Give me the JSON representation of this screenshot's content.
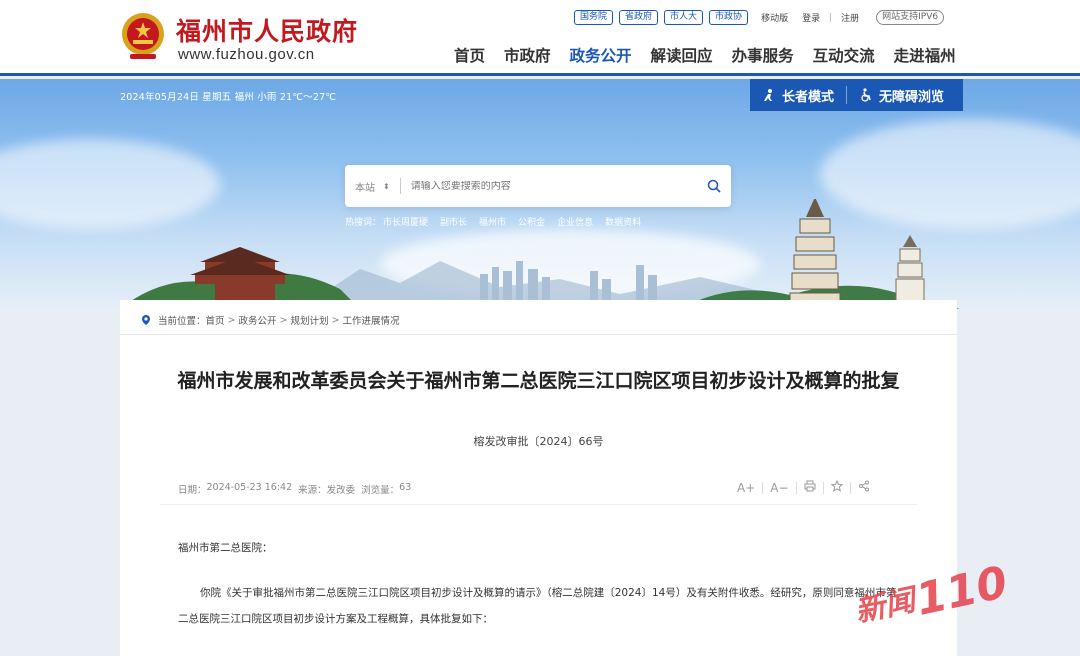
{
  "header": {
    "site_name": "福州市人民政府",
    "site_url": "www.fuzhou.gov.cn",
    "top_links": {
      "pills": [
        "国务院",
        "省政府",
        "市人大",
        "市政协"
      ],
      "mobile": "移动版",
      "login": "登录",
      "register": "注册",
      "ipv6": "网站支持IPV6"
    },
    "nav": [
      "首页",
      "市政府",
      "政务公开",
      "解读回应",
      "办事服务",
      "互动交流",
      "走进福州"
    ],
    "active_nav": "政务公开"
  },
  "banner": {
    "date_weather": "2024年05月24日 星期五 福州 小雨 21℃～27℃",
    "elder_mode": "长者模式",
    "accessible": "无障碍浏览",
    "search": {
      "scope": "本站",
      "placeholder": "请输入您要搜索的内容"
    },
    "hotwords_label": "热搜词：",
    "hotwords": [
      "市长周厦硬",
      "副市长",
      "福州市",
      "公积金",
      "企业信息",
      "数据资料"
    ]
  },
  "breadcrumb": {
    "label": "当前位置：",
    "items": [
      "首页",
      "政务公开",
      "规划计划",
      "工作进展情况"
    ]
  },
  "article": {
    "title": "福州市发展和改革委员会关于福州市第二总医院三江口院区项目初步设计及概算的批复",
    "doc_no": "榕发改审批〔2024〕66号",
    "meta": {
      "date_label": "日期：",
      "date": "2024-05-23 16:42",
      "source_label": "来源：",
      "source": "发改委",
      "views_label": "浏览量：",
      "views": "63"
    },
    "tools": {
      "font_up": "A+",
      "font_down": "A−"
    },
    "salutation": "福州市第二总医院：",
    "body": "你院《关于审批福州市第二总医院三江口院区项目初步设计及概算的请示》（榕二总院建〔2024〕14号）及有关附件收悉。经研究，原则同意福州市第二总医院三江口院区项目初步设计方案及工程概算，具体批复如下："
  },
  "watermark": {
    "text": "新闻110"
  },
  "colors": {
    "brand_blue": "#1a58b3",
    "brand_red": "#c3181e"
  }
}
